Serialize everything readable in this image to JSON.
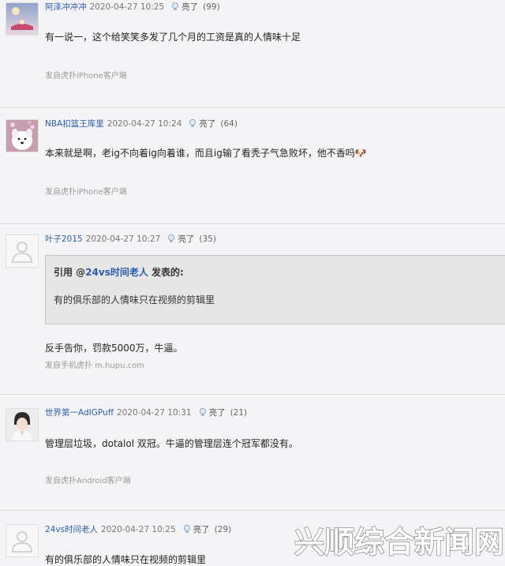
{
  "posts": [
    {
      "username": "阿泽冲冲冲",
      "date": "2020-04-27 10:25",
      "liang_label": "亮了",
      "like_count": "(99)",
      "text": "有一说一，这个给笑笑多发了几个月的工资是真的人情味十足",
      "source": "发自虎扑iPhone客户端"
    },
    {
      "username": "NBA扣篮王库里",
      "date": "2020-04-27 10:24",
      "liang_label": "亮了",
      "like_count": "(64)",
      "text": "本来就是啊，老ig不向着ig向着谁，而且ig输了看秃子气急败坏，他不香吗🐶",
      "source": "发自虎扑iPhone客户端"
    },
    {
      "username": "叶子2015",
      "date": "2020-04-27 10:27",
      "liang_label": "亮了",
      "like_count": "(35)",
      "quote_prefix": "引用 @",
      "quote_user": "24vs时间老人",
      "quote_suffix": " 发表的:",
      "quote_text": "有的俱乐部的人情味只在视频的剪辑里",
      "text": "反手告你，罚款5000万，牛逼。",
      "source": "发自手机虎扑 m.hupu.com"
    },
    {
      "username": "世界第一AdIGPuff",
      "date": "2020-04-27 10:31",
      "liang_label": "亮了",
      "like_count": "(21)",
      "text": "管理层垃圾，dotalol 双冠。牛逼的管理层连个冠军都没有。",
      "source": "发自虎扑Android客户端"
    },
    {
      "username": "24vs时间老人",
      "date": "2020-04-27 10:25",
      "liang_label": "亮了",
      "like_count": "(29)",
      "text": "有的俱乐部的人情味只在视频的剪辑里"
    }
  ],
  "watermark": "兴顺综合新闻网",
  "icons": {
    "like": "lightbulb-icon",
    "default_avatar": "default-avatar-icon"
  },
  "colors": {
    "username": "#2a5caa",
    "post_bg": "#f4f4f6",
    "quote_bg": "#e6e6e6",
    "watermark": "#ffffff"
  }
}
